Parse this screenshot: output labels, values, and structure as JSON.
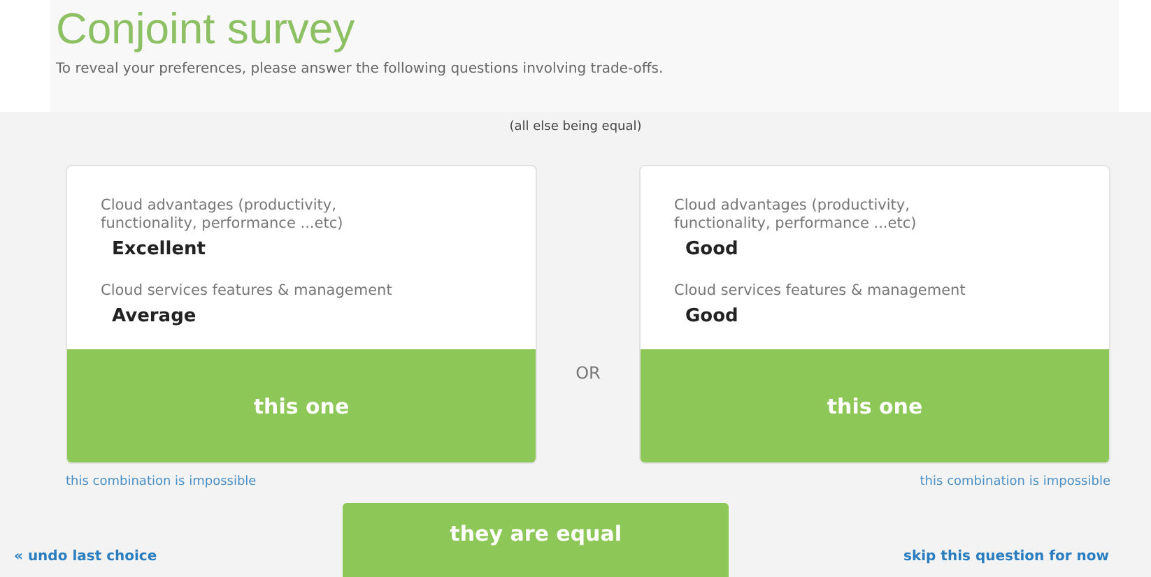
{
  "header": {
    "title": "Conjoint survey",
    "subtitle": "To reveal your preferences, please answer the following questions involving trade-offs."
  },
  "note": "(all else being equal)",
  "options": [
    {
      "attributes": [
        {
          "label": "Cloud advantages (productivity, functionality, performance ...etc)",
          "value": "Excellent"
        },
        {
          "label": "Cloud services features & management",
          "value": "Average"
        }
      ],
      "choose": "this one",
      "impossible": "this combination is impossible"
    },
    {
      "attributes": [
        {
          "label": "Cloud advantages (productivity, functionality, performance ...etc)",
          "value": "Good"
        },
        {
          "label": "Cloud services features & management",
          "value": "Good"
        }
      ],
      "choose": "this one",
      "impossible": "this combination is impossible"
    }
  ],
  "or": "OR",
  "undo": "« undo last choice",
  "equal": "they are equal",
  "skip": "skip this question for now"
}
